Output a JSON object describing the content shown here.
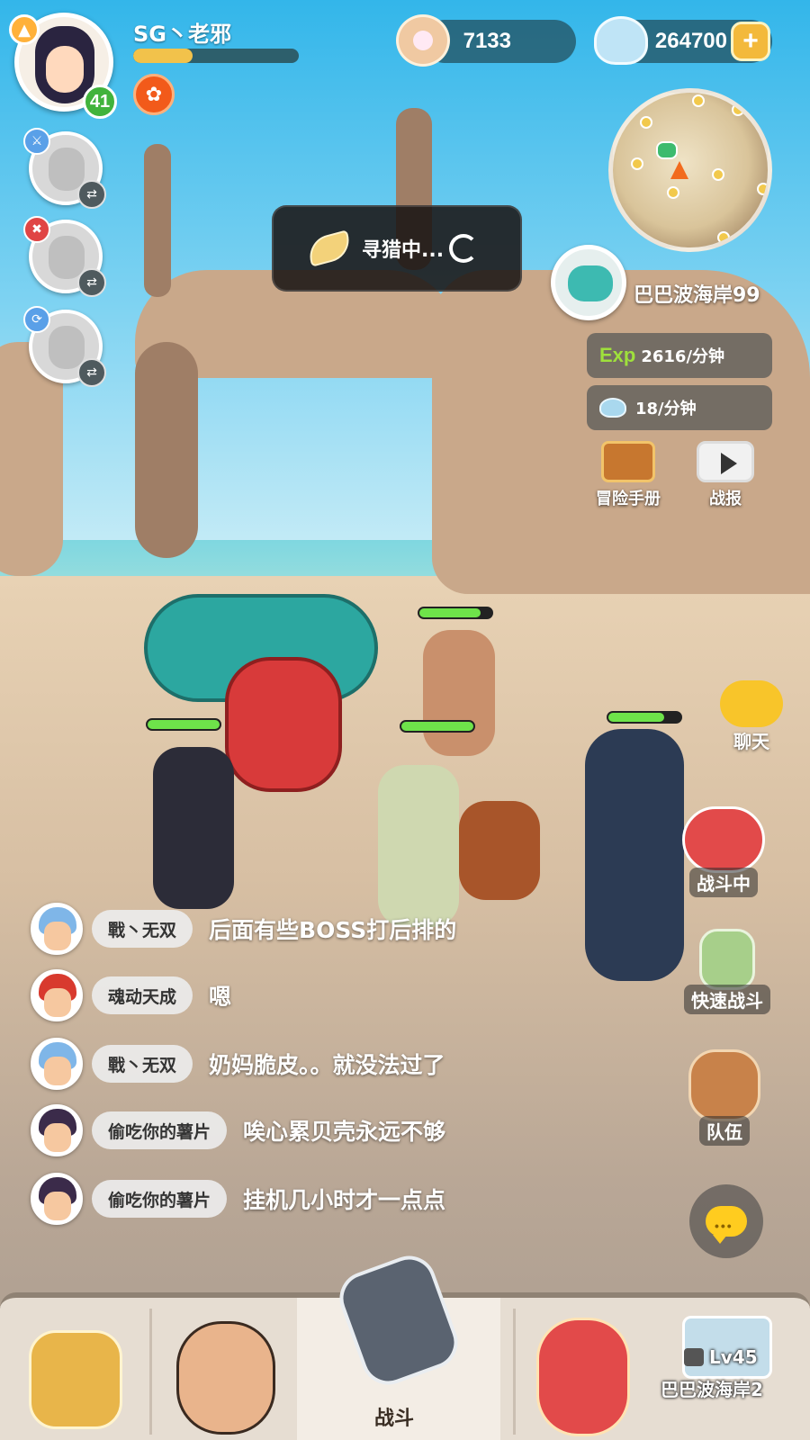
{
  "player": {
    "name": "SG丶老邪",
    "level": "41",
    "exp_progress": 0.36
  },
  "currency": {
    "pearls": "7133",
    "shells": "264700",
    "add_label": "+"
  },
  "hunting": {
    "text": "寻猎中..."
  },
  "location": {
    "name": "巴巴波海岸99",
    "exp_rate": "2616/分钟",
    "exp_prefix": "Exp",
    "shell_rate": "18/分钟"
  },
  "side_buttons": {
    "handbook": "冒险手册",
    "report": "战报",
    "chat": "聊天",
    "fighting": "战斗中",
    "quick_battle": "快速战斗",
    "team": "队伍"
  },
  "chat": [
    {
      "name": "戰丶无双",
      "message": "后面有些BOSS打后排的",
      "hair": "#7fb6e8"
    },
    {
      "name": "魂动天成",
      "message": "嗯",
      "hair": "#d83a2e"
    },
    {
      "name": "戰丶无双",
      "message": "奶妈脆皮。。就没法过了",
      "hair": "#7fb6e8"
    },
    {
      "name": "偷吃你的薯片",
      "message": "唉心累贝壳永远不够",
      "hair": "#3b2b4a"
    },
    {
      "name": "偷吃你的薯片",
      "message": "挂机几小时才一点点",
      "hair": "#3b2b4a"
    }
  ],
  "bottom_nav": {
    "battle": "战斗",
    "locked_level": "Lv45",
    "locked_area": "巴巴波海岸2"
  },
  "colors": {
    "exp_fill": "#f2c24b",
    "level_badge": "#41b33c",
    "hp": "#6ee34a"
  }
}
